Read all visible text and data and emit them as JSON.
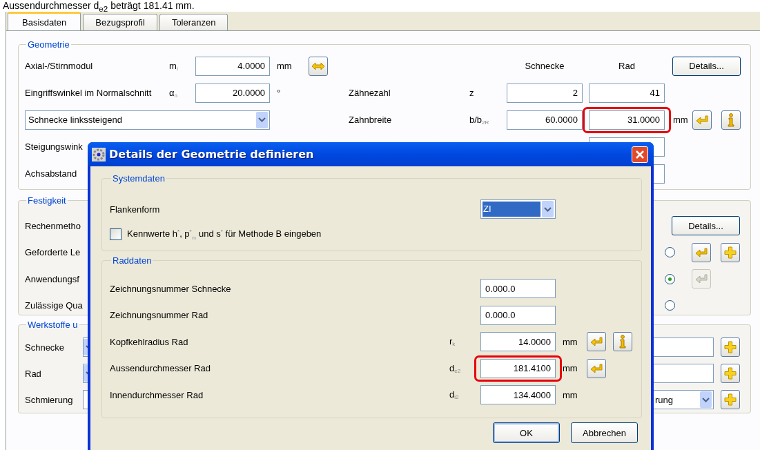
{
  "caption": "Aussendurchmesser d$_{e2}$ beträgt 181.41 mm.",
  "tabs": [
    {
      "label": "Basisdaten",
      "selected": true
    },
    {
      "label": "Bezugsprofil",
      "selected": false
    },
    {
      "label": "Toleranzen",
      "selected": false
    }
  ],
  "geometry": {
    "title": "Geometrie",
    "column_headers": [
      "Schnecke",
      "Rad"
    ],
    "details_button": "Details...",
    "module": {
      "label": "Axial-/Stirnmodul",
      "symbol": "m$_{t}$",
      "value": "4.0000",
      "unit": "mm"
    },
    "pressure_angle": {
      "label": "Eingriffswinkel im Normalschnitt",
      "symbol": "α$_{n}$",
      "value": "20.0000",
      "unit": "°"
    },
    "hand_dropdown": "Schnecke linkssteigend",
    "hidden_labels": [
      "Steigungswink",
      "Achsabstand"
    ],
    "teeth": {
      "label": "Zähnezahl",
      "symbol": "z",
      "values": [
        {
          "value": "2",
          "highlighted": false
        },
        {
          "value": "41",
          "highlighted": false
        }
      ]
    },
    "face_width": {
      "label": "Zahnbreite",
      "symbol": "b/b$_{2R}$",
      "unit": "mm",
      "values": [
        {
          "value": "60.0000",
          "highlighted": false
        },
        {
          "value": "31.0000",
          "highlighted": true
        }
      ]
    }
  },
  "strength": {
    "title": "Festigkeit",
    "details_button": "Details...",
    "rows": [
      {
        "label": "Rechenmetho",
        "kind": "details"
      },
      {
        "label": "Geforderte Le",
        "kind": "radio",
        "selected": false,
        "actions": [
          {
            "kind": "enter",
            "disabled": false
          },
          {
            "kind": "plus",
            "disabled": false
          }
        ]
      },
      {
        "label": "Anwendungsf",
        "kind": "radio",
        "selected": true,
        "actions": [
          {
            "kind": "enter",
            "disabled": true
          }
        ]
      },
      {
        "label": "Zulässige Qua",
        "kind": "radio",
        "selected": false,
        "actions": []
      }
    ]
  },
  "materials": {
    "title": "Werkstoffe u",
    "rows": [
      {
        "label": "Schnecke"
      },
      {
        "label": "Rad"
      },
      {
        "label": "Schmierung",
        "value": "rung"
      }
    ]
  },
  "dialog": {
    "title": "Details der Geometrie definieren",
    "system": {
      "title": "Systemdaten",
      "flank_label": "Flankenform",
      "flank_value": "ZI",
      "checkbox": {
        "label": "Kennwerte h$^{*}$, p$^{*}$$_{m}$ und s$^{*}$ für Methode B eingeben",
        "checked": false
      }
    },
    "wheel": {
      "title": "Raddaten",
      "rows": [
        {
          "label": "Zeichnungsnummer Schnecke",
          "kind": "text",
          "value": "0.000.0",
          "highlighted": false,
          "actions": []
        },
        {
          "label": "Zeichnungsnummer Rad",
          "kind": "text",
          "value": "0.000.0",
          "highlighted": false,
          "actions": []
        },
        {
          "label": "Kopfkehlradius Rad",
          "kind": "number",
          "symbol": "r$_{k}$",
          "value": "14.0000",
          "unit": "mm",
          "highlighted": false,
          "actions": [
            {
              "kind": "enter",
              "disabled": false
            },
            {
              "kind": "info",
              "disabled": false
            }
          ]
        },
        {
          "label": "Aussendurchmesser Rad",
          "kind": "number",
          "symbol": "d$_{e2}$",
          "value": "181.4100",
          "unit": "mm",
          "highlighted": true,
          "actions": [
            {
              "kind": "enter",
              "disabled": false
            }
          ]
        },
        {
          "label": "Innendurchmesser Rad",
          "kind": "number",
          "symbol": "d$_{i2}$",
          "value": "134.4000",
          "unit": "mm",
          "highlighted": false,
          "actions": []
        }
      ]
    },
    "buttons": [
      {
        "label": "OK",
        "kind": "default"
      },
      {
        "label": "Abbrechen",
        "kind": "normal"
      }
    ]
  }
}
